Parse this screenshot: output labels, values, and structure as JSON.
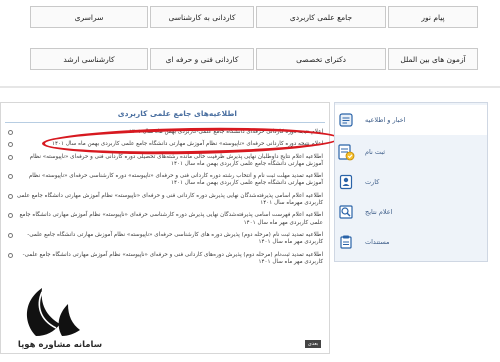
{
  "nav": {
    "row1": [
      "پیام نور",
      "جامع علمی کاربردی",
      "کاردانی به کارشناسی",
      "سراسری"
    ],
    "row2": [
      "آزمون های بین الملل",
      "دکترای تخصصی",
      "کاردانی فنی و حرفه ای",
      "کارشناسی ارشد"
    ]
  },
  "panel": {
    "title": "اطلاعیه‌های جامع علمی کاربردی",
    "items": [
      "اعلام نتیجه دوره کاردانی حرفه‌ای دانشگاه جامع علمی-کاربردی بهمن ماه سال ۱۴۰۱",
      "اعلام نتیجه دوره کاردانی حرفه‌ای «ناپیوسته» نظام آموزش مهارتی دانشگاه جامع علمی کاربردی بهمن ماه سال ۱۴۰۱",
      "اطلاعیه اعلام نتایج داوطلبان نهایی پذیرش ظرفیت خالی مانده رشته‌های تحصیلی دوره کاردانی فنی و حرفه‌ای «ناپیوسته» نظام آموزش مهارتی دانشگاه جامع علمی کاربردی بهمن ماه سال ۱۴۰۱",
      "اطلاعیه تمدید مهلت ثبت نام و انتخاب رشته دوره کاردانی فنی و حرفه‌ای «ناپیوسته» دوره کارشناسی حرفه‌ای «ناپیوسته» نظام آموزش مهارتی دانشگاه جامع علمی کاربردی بهمن ماه سال ۱۴۰۱",
      "اطلاعیه اعلام اسامی پذیرفته‌شدگان نهایی پذیرش دوره کاردانی فنی و حرفه‌ای «ناپیوسته» نظام آموزش مهارتی دانشگاه جامع علمی کاربردی مهرماه سال ۱۴۰۱",
      "اطلاعیه اعلام فهرست اسامی پذیرفته‌شدگان نهایی پذیرش دوره کارشناسی حرفه‌ای «ناپیوسته» نظام آموزش مهارتی دانشگاه جامع علمی کاربردی مهر ماه سال ۱۴۰۱",
      "اطلاعیه تمدید ثبت نام (مرحله دوم) پذیرش دوره های کارشناسی حرفه‌ای «ناپیوسته» نظام آموزش مهارتی دانشگاه جامع علمی-کاربردی مهر ماه سال ۱۴۰۱",
      "اطلاعیه تمدید ثبت‌نام (مرحله دوم) پذیرش دوره‌های کاردانی فنی و حرفه‌ای «ناپیوسته» نظام آموزش مهارتی دانشگاه جامع علمی-کاربردی مهر ماه سال ۱۴۰۱"
    ],
    "more_label": "بعدی"
  },
  "sidebar": {
    "items": [
      {
        "label": "اخبار و اطلاعیه",
        "icon": "news-icon",
        "color": "#2a63a8"
      },
      {
        "label": "ثبت نام",
        "icon": "register-icon",
        "color": "#2a63a8"
      },
      {
        "label": "کارت",
        "icon": "card-icon",
        "color": "#2a63a8"
      },
      {
        "label": "اعلام نتایج",
        "icon": "results-icon",
        "color": "#2a63a8"
      },
      {
        "label": "مستندات",
        "icon": "documents-icon",
        "color": "#2a63a8"
      }
    ]
  },
  "logo": {
    "text": "سامانه مشاوره هوپا",
    "color": "#1a1a1a"
  },
  "colors": {
    "highlight": "#d71920",
    "accent": "#4a6fa0"
  }
}
